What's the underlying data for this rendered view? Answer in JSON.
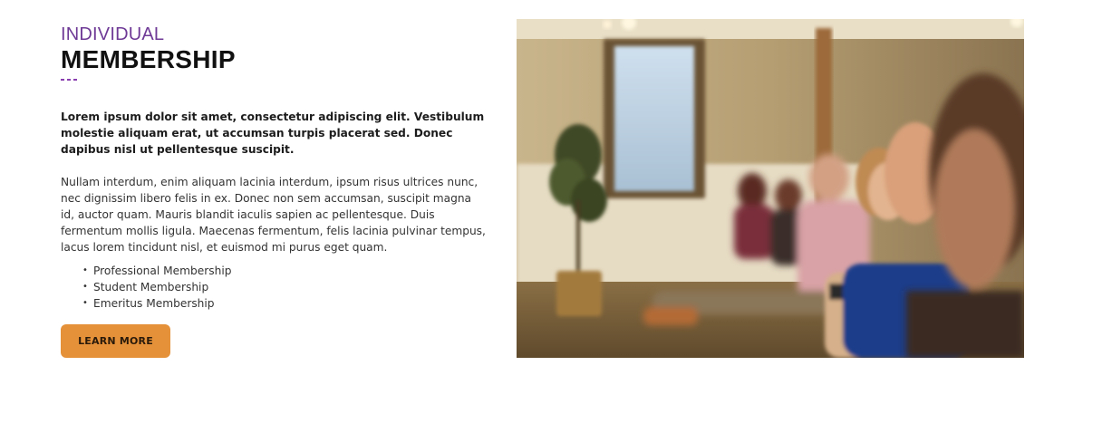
{
  "hero": {
    "eyebrow": "INDIVIDUAL",
    "title": "MEMBERSHIP",
    "lead": "Lorem ipsum dolor sit amet, consectetur adipiscing elit. Vestibulum molestie aliquam erat, ut accumsan turpis placerat sed. Donec dapibus nisl ut pellentesque suscipit.",
    "body": "Nullam interdum, enim aliquam lacinia interdum, ipsum risus ultrices nunc, nec dignissim libero felis in ex. Donec non sem accumsan, suscipit magna id, auctor quam. Mauris blandit iaculis sapien ac pellentesque. Duis fermentum mollis ligula. Maecenas fermentum, felis lacinia pulvinar tempus, lacus lorem tincidunt nisl, et euismod mi purus eget quam.",
    "bullets": [
      "Professional Membership",
      "Student Membership",
      "Emeritus Membership"
    ],
    "bullet_glyph": "•",
    "cta_label": "LEARN MORE"
  },
  "colors": {
    "accent_purple": "#6e3a96",
    "cta_orange": "#e4913a"
  }
}
